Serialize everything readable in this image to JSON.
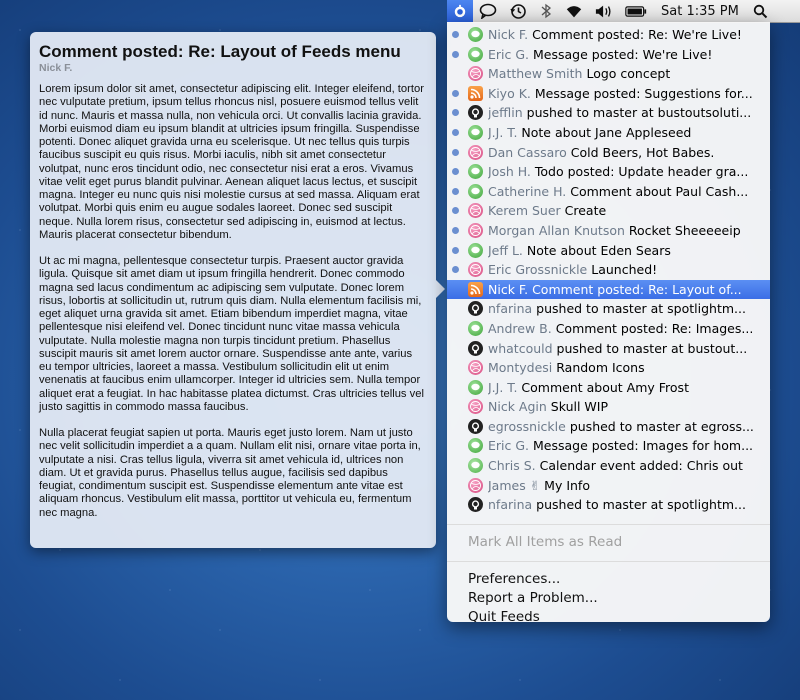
{
  "menubar": {
    "clock": "Sat 1:35 PM",
    "icons": [
      "feeds-icon",
      "chat-icon",
      "time-machine-icon",
      "bluetooth-icon",
      "wifi-icon",
      "volume-icon",
      "battery-icon",
      "spotlight-icon"
    ]
  },
  "popover": {
    "title": "Comment posted: Re: Layout of Feeds menu",
    "author": "Nick F.",
    "paragraphs": [
      "Lorem ipsum dolor sit amet, consectetur adipiscing elit. Integer eleifend, tortor nec vulputate pretium, ipsum tellus rhoncus nisl, posuere euismod tellus velit id nunc. Mauris et massa nulla, non vehicula orci. Ut convallis lacinia gravida. Morbi euismod diam eu ipsum blandit at ultricies ipsum fringilla. Suspendisse potenti. Donec aliquet gravida urna eu scelerisque. Ut nec tellus quis turpis faucibus suscipit eu quis risus. Morbi iaculis, nibh sit amet consectetur volutpat, nunc eros tincidunt odio, nec consectetur nisi erat a eros. Vivamus vitae velit eget purus blandit pulvinar. Aenean aliquet lacus lectus, et suscipit magna. Integer eu nunc quis nisi molestie cursus at sed massa. Aliquam erat volutpat. Morbi quis enim eu augue sodales laoreet. Donec sed suscipit neque. Nulla lorem risus, consectetur sed adipiscing in, euismod at lectus. Mauris placerat consectetur bibendum.",
      "Ut ac mi magna, pellentesque consectetur turpis. Praesent auctor gravida ligula. Quisque sit amet diam ut ipsum fringilla hendrerit. Donec commodo magna sed lacus condimentum ac adipiscing sem vulputate. Donec lorem risus, lobortis at sollicitudin ut, rutrum quis diam. Nulla elementum facilisis mi, eget aliquet urna gravida sit amet. Etiam bibendum imperdiet magna, vitae pellentesque nisi eleifend vel. Donec tincidunt nunc vitae massa vehicula vulputate. Nulla molestie magna non turpis tincidunt pretium. Phasellus suscipit mauris sit amet lorem auctor ornare. Suspendisse ante ante, varius eu tempor ultricies, laoreet a massa. Vestibulum sollicitudin elit ut enim venenatis at faucibus enim ullamcorper. Integer id ultricies sem. Nulla tempor aliquet erat a feugiat. In hac habitasse platea dictumst. Cras ultricies tellus vel justo sagittis in commodo massa faucibus.",
      "Nulla placerat feugiat sapien ut porta. Mauris eget justo lorem. Nam ut justo nec velit sollicitudin imperdiet a a quam. Nullam elit nisi, ornare vitae porta in, vulputate a nisi. Cras tellus ligula, viverra sit amet vehicula id, ultrices non diam. Ut et gravida purus. Phasellus tellus augue, facilisis sed dapibus feugiat, condimentum suscipit est. Suspendisse elementum ante vitae est aliquam rhoncus. Vestibulum elit massa, porttitor ut vehicula eu, fermentum nec magna."
    ]
  },
  "menu": {
    "items": [
      {
        "unread": true,
        "icon": "imessage",
        "author": "Nick F.",
        "title": "Comment posted: Re: We're Live!"
      },
      {
        "unread": true,
        "icon": "imessage",
        "author": "Eric G.",
        "title": "Message posted: We're Live!"
      },
      {
        "unread": false,
        "icon": "dribbble",
        "author": "Matthew Smith",
        "title": "Logo concept"
      },
      {
        "unread": true,
        "icon": "rss",
        "author": "Kiyo K.",
        "title": "Message posted: Suggestions for..."
      },
      {
        "unread": true,
        "icon": "github",
        "author": "jefflin",
        "title": "pushed to master at bustoutsoluti..."
      },
      {
        "unread": true,
        "icon": "imessage",
        "author": "J.J. T.",
        "title": "Note about Jane Appleseed"
      },
      {
        "unread": true,
        "icon": "dribbble",
        "author": "Dan Cassaro",
        "title": " Cold Beers, Hot Babes."
      },
      {
        "unread": true,
        "icon": "imessage",
        "author": "Josh H.",
        "title": "Todo posted: Update header gra..."
      },
      {
        "unread": true,
        "icon": "imessage",
        "author": "Catherine H.",
        "title": "Comment about Paul Cash..."
      },
      {
        "unread": true,
        "icon": "dribbble",
        "author": "Kerem Suer",
        "title": "Create"
      },
      {
        "unread": true,
        "icon": "dribbble",
        "author": "Morgan Allan Knutson",
        "title": "Rocket Sheeeeeip"
      },
      {
        "unread": true,
        "icon": "imessage",
        "author": "Jeff L.",
        "title": "Note about Eden Sears"
      },
      {
        "unread": true,
        "icon": "dribbble",
        "author": "Eric Grossnickle",
        "title": "Launched!"
      },
      {
        "unread": false,
        "icon": "rss",
        "author": "Nick F.",
        "title": "Comment posted: Re: Layout of...",
        "selected": true
      },
      {
        "unread": false,
        "icon": "github",
        "author": "nfarina",
        "title": "pushed to master at spotlightm..."
      },
      {
        "unread": false,
        "icon": "imessage",
        "author": "Andrew B.",
        "title": "Comment posted: Re: Images..."
      },
      {
        "unread": false,
        "icon": "github",
        "author": "whatcould",
        "title": "pushed to master at bustout..."
      },
      {
        "unread": false,
        "icon": "dribbble",
        "author": "Montydesi",
        "title": "Random Icons"
      },
      {
        "unread": false,
        "icon": "imessage",
        "author": "J.J. T.",
        "title": "Comment about Amy Frost"
      },
      {
        "unread": false,
        "icon": "dribbble",
        "author": "Nick Agin",
        "title": "Skull WIP"
      },
      {
        "unread": false,
        "icon": "github",
        "author": "egrossnickle",
        "title": "pushed to master at egross..."
      },
      {
        "unread": false,
        "icon": "imessage",
        "author": "Eric G.",
        "title": "Message posted: Images for hom..."
      },
      {
        "unread": false,
        "icon": "calendar",
        "author": "Chris S.",
        "title": "Calendar event added: Chris out"
      },
      {
        "unread": false,
        "icon": "dribbble",
        "author": "James ✌",
        "title": "My Info"
      },
      {
        "unread": false,
        "icon": "github",
        "author": "nfarina",
        "title": "pushed to master at spotlightm..."
      }
    ],
    "mark_all_label": "Mark All Items as Read",
    "commands": [
      "Preferences...",
      "Report a Problem...",
      "Quit Feeds"
    ]
  },
  "colors": {
    "selection": "#3b6ee6",
    "unread_dot": "#6b8fd0",
    "author": "#6d7a8a"
  }
}
